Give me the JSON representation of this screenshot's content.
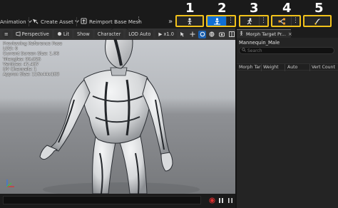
{
  "toolbar": {
    "animation_label": "Animation",
    "create_asset_label": "Create Asset",
    "reimport_label": "Reimport Base Mesh",
    "expand_glyph": "»"
  },
  "modes": [
    {
      "number": "1",
      "icon": "skeleton-icon"
    },
    {
      "number": "2",
      "icon": "skeletal-mesh-icon"
    },
    {
      "number": "3",
      "icon": "animation-icon"
    },
    {
      "number": "4",
      "icon": "blueprint-icon"
    },
    {
      "number": "5",
      "icon": "physics-icon"
    }
  ],
  "viewport": {
    "view_mode": "Perspective",
    "lighting": "Lit",
    "show": "Show",
    "character": "Character",
    "lod": "LOD Auto",
    "play_speed": "x1.0",
    "stats": [
      "Previewing Reference Pose",
      "LOD: 0",
      "Current Screen Size: 1.06",
      "Triangles: 90,026",
      "Vertices: 47,487",
      "UV Channels: 1",
      "Approx Size: 116x44x183"
    ]
  },
  "morph_panel": {
    "tab_title": "Morph Target Pr...",
    "asset_name": "Mannequin_Male",
    "search_placeholder": "Search",
    "columns": [
      "Morph Tar",
      "Weight",
      "Auto",
      "Vert Count"
    ]
  },
  "colors": {
    "highlight": "#f2c21b",
    "active_blue": "#0f6fd6",
    "record_red": "#e03030"
  }
}
